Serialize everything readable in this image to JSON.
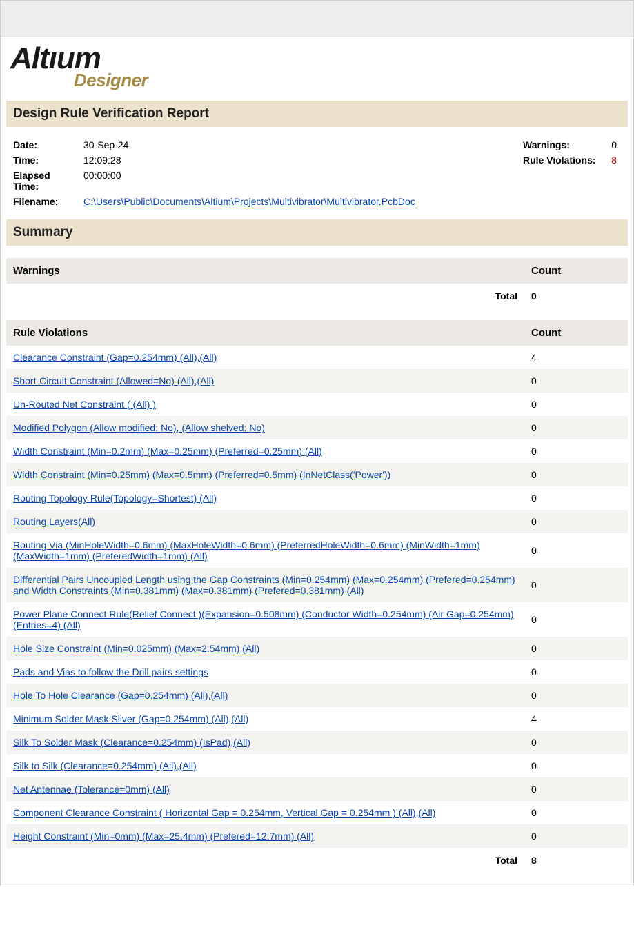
{
  "logo": {
    "brand": "Altıum",
    "product": "Designer"
  },
  "report_title": "Design Rule Verification Report",
  "meta": {
    "date_label": "Date:",
    "date": "30-Sep-24",
    "time_label": "Time:",
    "time": "12:09:28",
    "elapsed_label": "Elapsed Time:",
    "elapsed": "00:00:00",
    "filename_label": "Filename:",
    "filename": "C:\\Users\\Public\\Documents\\Altium\\Projects\\Multivibrator\\Multivibrator.PcbDoc",
    "warnings_label": "Warnings:",
    "warnings": "0",
    "violations_label": "Rule Violations:",
    "violations": "8"
  },
  "summary_title": "Summary",
  "warnings_table": {
    "header_left": "Warnings",
    "header_right": "Count",
    "total_label": "Total",
    "total_value": "0"
  },
  "violations_table": {
    "header_left": "Rule Violations",
    "header_right": "Count",
    "rows": [
      {
        "label": "Clearance Constraint (Gap=0.254mm) (All),(All)",
        "count": "4"
      },
      {
        "label": "Short-Circuit Constraint (Allowed=No) (All),(All)",
        "count": "0"
      },
      {
        "label": "Un-Routed Net Constraint ( (All) )",
        "count": "0"
      },
      {
        "label": "Modified Polygon (Allow modified: No), (Allow shelved: No)",
        "count": "0"
      },
      {
        "label": "Width Constraint (Min=0.2mm) (Max=0.25mm) (Preferred=0.25mm) (All)",
        "count": "0"
      },
      {
        "label": "Width Constraint (Min=0.25mm) (Max=0.5mm) (Preferred=0.5mm) (InNetClass('Power'))",
        "count": "0"
      },
      {
        "label": "Routing Topology Rule(Topology=Shortest) (All)",
        "count": "0"
      },
      {
        "label": "Routing Layers(All)",
        "count": "0"
      },
      {
        "label": "Routing Via (MinHoleWidth=0.6mm) (MaxHoleWidth=0.6mm) (PreferredHoleWidth=0.6mm) (MinWidth=1mm) (MaxWidth=1mm) (PreferedWidth=1mm) (All)",
        "count": "0"
      },
      {
        "label": "Differential Pairs Uncoupled Length using the Gap Constraints (Min=0.254mm) (Max=0.254mm) (Prefered=0.254mm) and Width Constraints (Min=0.381mm) (Max=0.381mm) (Prefered=0.381mm) (All)",
        "count": "0"
      },
      {
        "label": "Power Plane Connect Rule(Relief Connect )(Expansion=0.508mm) (Conductor Width=0.254mm) (Air Gap=0.254mm) (Entries=4) (All)",
        "count": "0"
      },
      {
        "label": "Hole Size Constraint (Min=0.025mm) (Max=2.54mm) (All)",
        "count": "0"
      },
      {
        "label": "Pads and Vias to follow the Drill pairs settings",
        "count": "0"
      },
      {
        "label": "Hole To Hole Clearance (Gap=0.254mm) (All),(All)",
        "count": "0"
      },
      {
        "label": "Minimum Solder Mask Sliver (Gap=0.254mm) (All),(All)",
        "count": "4"
      },
      {
        "label": "Silk To Solder Mask (Clearance=0.254mm) (IsPad),(All)",
        "count": "0"
      },
      {
        "label": "Silk to Silk (Clearance=0.254mm) (All),(All)",
        "count": "0"
      },
      {
        "label": "Net Antennae (Tolerance=0mm) (All)",
        "count": "0"
      },
      {
        "label": "Component Clearance Constraint ( Horizontal Gap = 0.254mm, Vertical Gap = 0.254mm ) (All),(All)",
        "count": "0"
      },
      {
        "label": "Height Constraint (Min=0mm) (Max=25.4mm) (Prefered=12.7mm) (All)",
        "count": "0"
      }
    ],
    "total_label": "Total",
    "total_value": "8"
  }
}
